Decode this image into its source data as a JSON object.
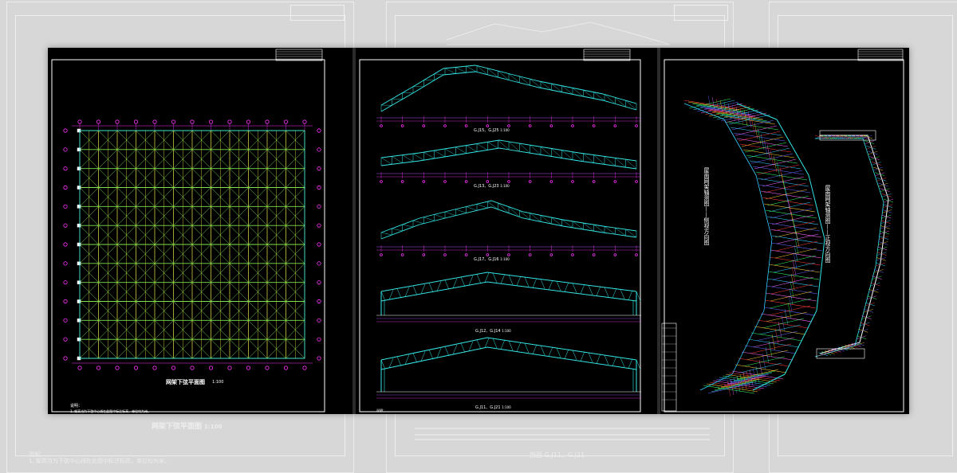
{
  "background": {
    "color": "#d7d7d7",
    "ghost_plan_title": "网架下弦平面图",
    "ghost_plan_scale": "1:100",
    "ghost_note": "1. 架高当为下弦中心线在此图中标注标高，单位均为米。",
    "ghost_section_title": "剖面 G.J11、G.J21",
    "ghost_notes_label": "说明："
  },
  "panel_left": {
    "title": "网架下弦平面图",
    "scale": "1:100",
    "notes_heading": "说明：",
    "note_1": "1. 架高当为下弦中心线在此图中标注标高，单位均为米。"
  },
  "panel_middle": {
    "captions": [
      "G.J15、G.J25",
      "G.J13、G.J23",
      "G.J17、G.J16",
      "G.J12、G.J14",
      "G.J11、G.J21"
    ],
    "scale": "1:100",
    "notes_heading": "说明："
  },
  "panel_right": {
    "label_left": "屋面网架轴测图——侧视方向图",
    "label_right": "屋面网架轴测图——正视方向图"
  },
  "colors": {
    "frame": "#ffffff",
    "axis": "#ff33ff",
    "truss": "#33e6e6",
    "grid_green": "#7fe24d",
    "grid_yellow": "#e8e84a",
    "dim": "#b04cff",
    "rainbow": [
      "#ff3b3b",
      "#ffcc33",
      "#33ff66",
      "#33ccff",
      "#6666ff",
      "#ff66ff"
    ]
  }
}
